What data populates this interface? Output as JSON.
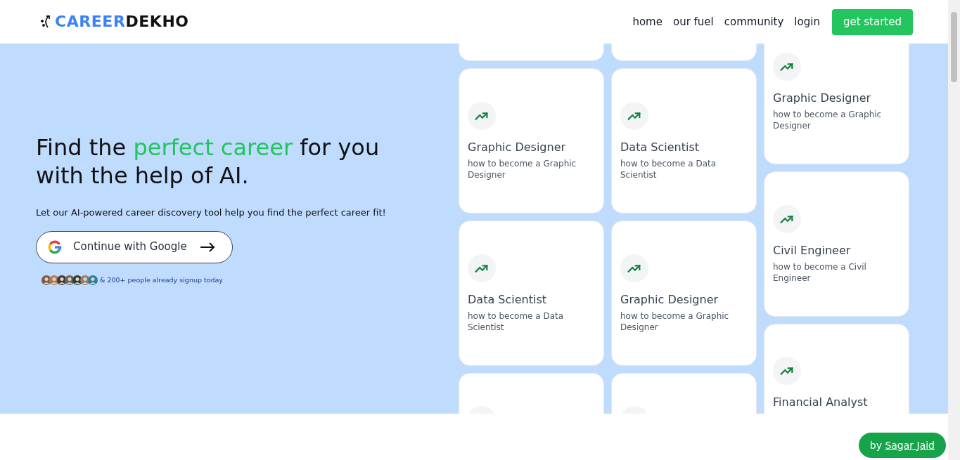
{
  "header": {
    "logo": {
      "first": "CAREER",
      "second": "DEKHO"
    },
    "nav": [
      "home",
      "our fuel",
      "community",
      "login"
    ],
    "cta": "get started"
  },
  "hero": {
    "headline": [
      {
        "text": "Find the ",
        "highlight": false
      },
      {
        "text": "perfect career",
        "highlight": true
      },
      {
        "text": " for you with the help of AI.",
        "highlight": false
      }
    ],
    "subtitle": "Let our AI-powered career discovery tool help you find the perfect career fit!",
    "google_button": "Continue with Google",
    "avatars": [
      {
        "color": "#7c5a48"
      },
      {
        "color": "#b07a5a"
      },
      {
        "color": "#3f3a36"
      },
      {
        "color": "#6b6460"
      },
      {
        "color": "#2f3b3a"
      },
      {
        "color": "#9a7a66"
      },
      {
        "color": "#2a7f9a"
      }
    ],
    "social_proof": "& 200+ people already signup today"
  },
  "columns": [
    {
      "cards": [
        {
          "kind": "blank"
        },
        {
          "kind": "career",
          "title": "Graphic Designer",
          "description": "how to become a Graphic Designer"
        },
        {
          "kind": "career",
          "title": "Data Scientist",
          "description": "how to become a Data Scientist"
        },
        {
          "kind": "icon_only"
        }
      ]
    },
    {
      "cards": [
        {
          "kind": "blank"
        },
        {
          "kind": "career",
          "title": "Data Scientist",
          "description": "how to become a Data Scientist"
        },
        {
          "kind": "career",
          "title": "Graphic Designer",
          "description": "how to become a Graphic Designer"
        },
        {
          "kind": "icon_only"
        }
      ]
    },
    {
      "cards": [
        {
          "kind": "career",
          "title": "Graphic Designer",
          "description": "how to become a Graphic Designer"
        },
        {
          "kind": "career",
          "title": "Civil Engineer",
          "description": "how to become a Civil Engineer"
        },
        {
          "kind": "career",
          "title": "Financial Analyst"
        }
      ]
    }
  ],
  "credit": {
    "prefix": "by ",
    "link": "Sagar Jaid"
  }
}
